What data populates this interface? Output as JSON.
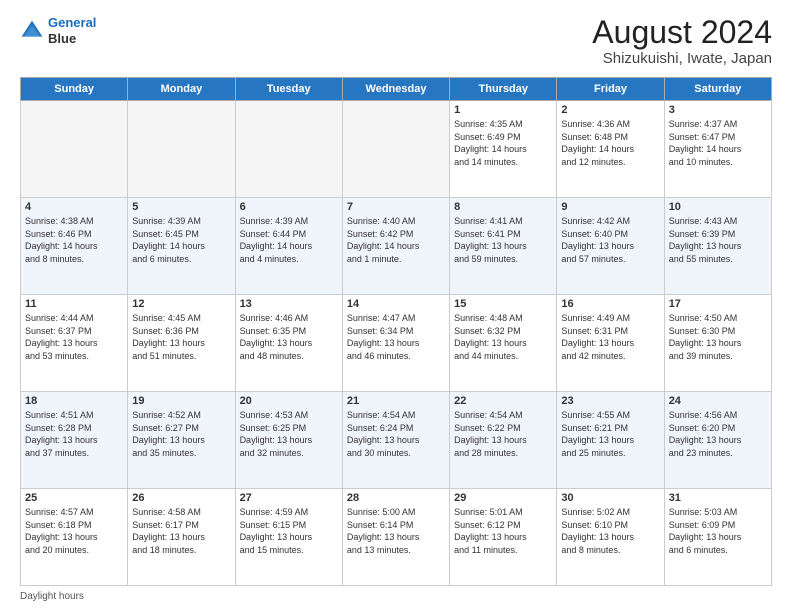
{
  "header": {
    "logo_line1": "General",
    "logo_line2": "Blue",
    "main_title": "August 2024",
    "subtitle": "Shizukuishi, Iwate, Japan"
  },
  "days_of_week": [
    "Sunday",
    "Monday",
    "Tuesday",
    "Wednesday",
    "Thursday",
    "Friday",
    "Saturday"
  ],
  "footer_text": "Daylight hours",
  "weeks": [
    [
      {
        "day": "",
        "info": ""
      },
      {
        "day": "",
        "info": ""
      },
      {
        "day": "",
        "info": ""
      },
      {
        "day": "",
        "info": ""
      },
      {
        "day": "1",
        "info": "Sunrise: 4:35 AM\nSunset: 6:49 PM\nDaylight: 14 hours\nand 14 minutes."
      },
      {
        "day": "2",
        "info": "Sunrise: 4:36 AM\nSunset: 6:48 PM\nDaylight: 14 hours\nand 12 minutes."
      },
      {
        "day": "3",
        "info": "Sunrise: 4:37 AM\nSunset: 6:47 PM\nDaylight: 14 hours\nand 10 minutes."
      }
    ],
    [
      {
        "day": "4",
        "info": "Sunrise: 4:38 AM\nSunset: 6:46 PM\nDaylight: 14 hours\nand 8 minutes."
      },
      {
        "day": "5",
        "info": "Sunrise: 4:39 AM\nSunset: 6:45 PM\nDaylight: 14 hours\nand 6 minutes."
      },
      {
        "day": "6",
        "info": "Sunrise: 4:39 AM\nSunset: 6:44 PM\nDaylight: 14 hours\nand 4 minutes."
      },
      {
        "day": "7",
        "info": "Sunrise: 4:40 AM\nSunset: 6:42 PM\nDaylight: 14 hours\nand 1 minute."
      },
      {
        "day": "8",
        "info": "Sunrise: 4:41 AM\nSunset: 6:41 PM\nDaylight: 13 hours\nand 59 minutes."
      },
      {
        "day": "9",
        "info": "Sunrise: 4:42 AM\nSunset: 6:40 PM\nDaylight: 13 hours\nand 57 minutes."
      },
      {
        "day": "10",
        "info": "Sunrise: 4:43 AM\nSunset: 6:39 PM\nDaylight: 13 hours\nand 55 minutes."
      }
    ],
    [
      {
        "day": "11",
        "info": "Sunrise: 4:44 AM\nSunset: 6:37 PM\nDaylight: 13 hours\nand 53 minutes."
      },
      {
        "day": "12",
        "info": "Sunrise: 4:45 AM\nSunset: 6:36 PM\nDaylight: 13 hours\nand 51 minutes."
      },
      {
        "day": "13",
        "info": "Sunrise: 4:46 AM\nSunset: 6:35 PM\nDaylight: 13 hours\nand 48 minutes."
      },
      {
        "day": "14",
        "info": "Sunrise: 4:47 AM\nSunset: 6:34 PM\nDaylight: 13 hours\nand 46 minutes."
      },
      {
        "day": "15",
        "info": "Sunrise: 4:48 AM\nSunset: 6:32 PM\nDaylight: 13 hours\nand 44 minutes."
      },
      {
        "day": "16",
        "info": "Sunrise: 4:49 AM\nSunset: 6:31 PM\nDaylight: 13 hours\nand 42 minutes."
      },
      {
        "day": "17",
        "info": "Sunrise: 4:50 AM\nSunset: 6:30 PM\nDaylight: 13 hours\nand 39 minutes."
      }
    ],
    [
      {
        "day": "18",
        "info": "Sunrise: 4:51 AM\nSunset: 6:28 PM\nDaylight: 13 hours\nand 37 minutes."
      },
      {
        "day": "19",
        "info": "Sunrise: 4:52 AM\nSunset: 6:27 PM\nDaylight: 13 hours\nand 35 minutes."
      },
      {
        "day": "20",
        "info": "Sunrise: 4:53 AM\nSunset: 6:25 PM\nDaylight: 13 hours\nand 32 minutes."
      },
      {
        "day": "21",
        "info": "Sunrise: 4:54 AM\nSunset: 6:24 PM\nDaylight: 13 hours\nand 30 minutes."
      },
      {
        "day": "22",
        "info": "Sunrise: 4:54 AM\nSunset: 6:22 PM\nDaylight: 13 hours\nand 28 minutes."
      },
      {
        "day": "23",
        "info": "Sunrise: 4:55 AM\nSunset: 6:21 PM\nDaylight: 13 hours\nand 25 minutes."
      },
      {
        "day": "24",
        "info": "Sunrise: 4:56 AM\nSunset: 6:20 PM\nDaylight: 13 hours\nand 23 minutes."
      }
    ],
    [
      {
        "day": "25",
        "info": "Sunrise: 4:57 AM\nSunset: 6:18 PM\nDaylight: 13 hours\nand 20 minutes."
      },
      {
        "day": "26",
        "info": "Sunrise: 4:58 AM\nSunset: 6:17 PM\nDaylight: 13 hours\nand 18 minutes."
      },
      {
        "day": "27",
        "info": "Sunrise: 4:59 AM\nSunset: 6:15 PM\nDaylight: 13 hours\nand 15 minutes."
      },
      {
        "day": "28",
        "info": "Sunrise: 5:00 AM\nSunset: 6:14 PM\nDaylight: 13 hours\nand 13 minutes."
      },
      {
        "day": "29",
        "info": "Sunrise: 5:01 AM\nSunset: 6:12 PM\nDaylight: 13 hours\nand 11 minutes."
      },
      {
        "day": "30",
        "info": "Sunrise: 5:02 AM\nSunset: 6:10 PM\nDaylight: 13 hours\nand 8 minutes."
      },
      {
        "day": "31",
        "info": "Sunrise: 5:03 AM\nSunset: 6:09 PM\nDaylight: 13 hours\nand 6 minutes."
      }
    ]
  ]
}
